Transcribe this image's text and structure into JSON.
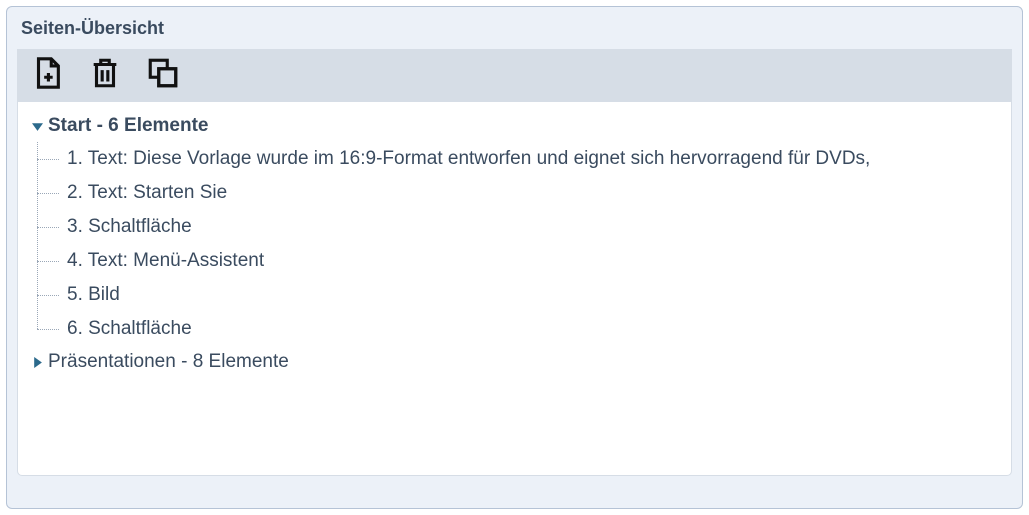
{
  "panel": {
    "title": "Seiten-Übersicht"
  },
  "toolbar": {
    "add_label": "Neu",
    "delete_label": "Löschen",
    "copy_label": "Kopieren"
  },
  "tree": {
    "nodes": [
      {
        "label": "Start - 6 Elemente",
        "expanded": true,
        "children": [
          {
            "label": "1. Text: Diese Vorlage wurde im 16:9-Format entworfen und eignet sich hervorragend für DVDs,"
          },
          {
            "label": "2. Text: Starten Sie"
          },
          {
            "label": "3. Schaltfläche"
          },
          {
            "label": "4. Text: Menü-Assistent"
          },
          {
            "label": "5. Bild"
          },
          {
            "label": "6. Schaltfläche"
          }
        ]
      },
      {
        "label": "Präsentationen - 8 Elemente",
        "expanded": false
      }
    ]
  }
}
